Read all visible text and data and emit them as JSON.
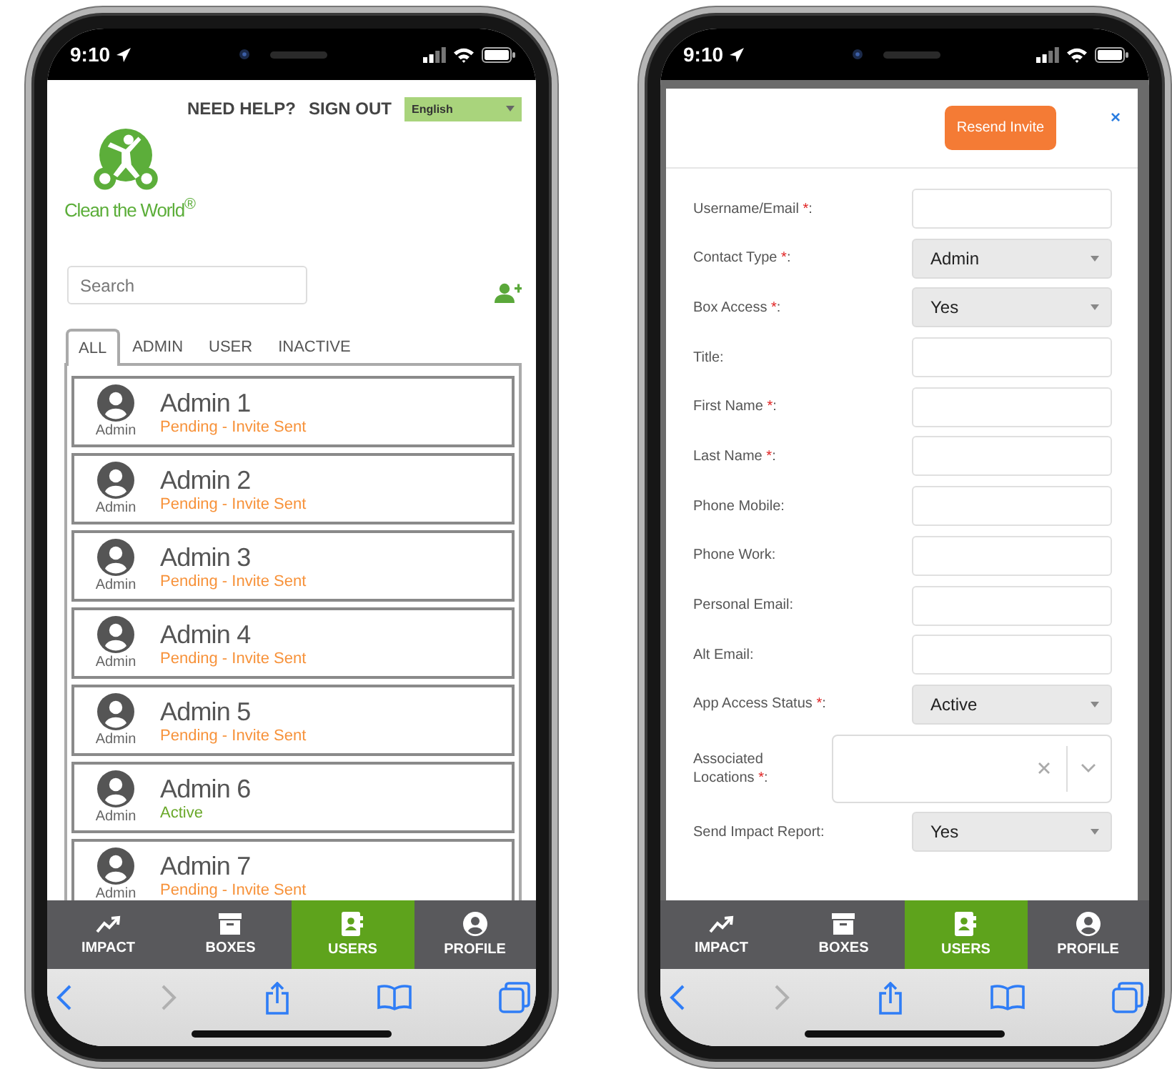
{
  "phones": [
    {
      "kind": "user_list",
      "status_bar": {
        "time": "9:10"
      },
      "header": {
        "links": [
          "NEED HELP?",
          "SIGN OUT"
        ],
        "language": "English"
      },
      "logo": {
        "text": "Clean the World$^{®}$"
      },
      "search": {
        "placeholder": "Search"
      },
      "filter_tabs": [
        {
          "label": "ALL",
          "selected": true
        },
        {
          "label": "ADMIN",
          "selected": false
        },
        {
          "label": "USER",
          "selected": false
        },
        {
          "label": "INACTIVE",
          "selected": false
        }
      ],
      "users": [
        {
          "name": "Admin 1",
          "role": "Admin",
          "status": "Pending - Invite Sent",
          "color": "#f7923a"
        },
        {
          "name": "Admin 2",
          "role": "Admin",
          "status": "Pending - Invite Sent",
          "color": "#f7923a"
        },
        {
          "name": "Admin 3",
          "role": "Admin",
          "status": "Pending - Invite Sent",
          "color": "#f7923a"
        },
        {
          "name": "Admin 4",
          "role": "Admin",
          "status": "Pending - Invite Sent",
          "color": "#f7923a"
        },
        {
          "name": "Admin 5",
          "role": "Admin",
          "status": "Pending - Invite Sent",
          "color": "#f7923a"
        },
        {
          "name": "Admin 6",
          "role": "Admin",
          "status": "Active",
          "color": "#6aa82a"
        },
        {
          "name": "Admin 7",
          "role": "Admin",
          "status": "Pending - Invite Sent",
          "color": "#f7923a"
        }
      ],
      "tab_bar": [
        {
          "kind": "impact",
          "label": "IMPACT",
          "selected": false
        },
        {
          "kind": "boxes",
          "label": "BOXES",
          "selected": false
        },
        {
          "kind": "users",
          "label": "USERS",
          "selected": true
        },
        {
          "kind": "profile",
          "label": "PROFILE",
          "selected": false
        }
      ],
      "browser_toolbar": [
        {
          "kind": "back",
          "disabled": false
        },
        {
          "kind": "forward",
          "disabled": true
        },
        {
          "kind": "share",
          "disabled": false
        },
        {
          "kind": "bookmarks",
          "disabled": false
        },
        {
          "kind": "tabs",
          "disabled": false
        }
      ]
    },
    {
      "kind": "user_form",
      "status_bar": {
        "time": "9:10"
      },
      "modal": {
        "button": "Resend Invite",
        "close": "×",
        "fields": [
          {
            "kind": "text",
            "label": "Username/Email",
            "required": "*",
            "label_end": ":"
          },
          {
            "kind": "select",
            "label": "Contact Type",
            "required": "*",
            "label_end": ":",
            "value": "Admin"
          },
          {
            "kind": "select",
            "label": "Box Access",
            "required": "*",
            "label_end": ":",
            "value": "Yes"
          },
          {
            "kind": "text",
            "label": "Title",
            "label_end": ":"
          },
          {
            "kind": "text",
            "label": "First Name",
            "required": "*",
            "label_end": ":"
          },
          {
            "kind": "text",
            "label": "Last Name",
            "required": "*",
            "label_end": ":"
          },
          {
            "kind": "text",
            "label": "Phone Mobile",
            "label_end": ":"
          },
          {
            "kind": "text",
            "label": "Phone Work",
            "label_end": ":"
          },
          {
            "kind": "text",
            "label": "Personal Email",
            "label_end": ":"
          },
          {
            "kind": "text",
            "label": "Alt Email",
            "label_end": ":"
          },
          {
            "kind": "select",
            "label": "App Access Status",
            "required": "*",
            "label_end": ":",
            "value": "Active"
          },
          {
            "kind": "multiselect",
            "label": "Associated Locations",
            "required": "*",
            "label_end": ":"
          },
          {
            "kind": "select",
            "label": "Send Impact Report",
            "label_end": ":",
            "value": "Yes"
          }
        ]
      },
      "tab_bar": [
        {
          "kind": "impact",
          "label": "IMPACT",
          "selected": false
        },
        {
          "kind": "boxes",
          "label": "BOXES",
          "selected": false
        },
        {
          "kind": "users",
          "label": "USERS",
          "selected": true
        },
        {
          "kind": "profile",
          "label": "PROFILE",
          "selected": false
        }
      ],
      "browser_toolbar": [
        {
          "kind": "back",
          "disabled": false
        },
        {
          "kind": "forward",
          "disabled": true
        },
        {
          "kind": "share",
          "disabled": false
        },
        {
          "kind": "bookmarks",
          "disabled": false
        },
        {
          "kind": "tabs",
          "disabled": false
        }
      ]
    }
  ]
}
